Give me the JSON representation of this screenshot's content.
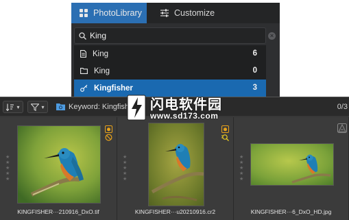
{
  "tabs": [
    {
      "label": "PhotoLibrary",
      "icon": "grid-icon",
      "active": true
    },
    {
      "label": "Customize",
      "icon": "sliders-icon",
      "active": false
    }
  ],
  "search": {
    "value": "King",
    "clear_icon": "×"
  },
  "results": [
    {
      "label": "King",
      "count": "6",
      "icon": "file-icon",
      "selected": false
    },
    {
      "label": "King",
      "count": "0",
      "icon": "folder-icon",
      "selected": false
    },
    {
      "label": "Kingfisher",
      "count": "3",
      "icon": "keyword-tag-icon",
      "selected": true
    }
  ],
  "toolbar": {
    "sort_caret": "▾",
    "filter_caret": "▾",
    "keyword_label": "Keyword: Kingfisher",
    "count_label": "0/3"
  },
  "thumbnails": [
    {
      "filename": "KINGFISHER···210916_DxO.tif",
      "badges": [
        "photo-badge-icon",
        "no-entry-badge-icon"
      ]
    },
    {
      "filename": "KINGFISHER···u20210916.cr2",
      "badges": [
        "photo-badge-icon",
        "zoom-badge-icon"
      ]
    },
    {
      "filename": "KINGFISHER···6_DxO_HD.jpg",
      "badges": [
        "exposure-warning-icon"
      ]
    }
  ],
  "watermark": {
    "title": "闪电软件园",
    "url": "www.sd173.com"
  },
  "colors": {
    "accent": "#2b6fb3",
    "selected_row": "#1a69b0",
    "badge_orange": "#e8a21a",
    "badge_yellow": "#f0d020"
  }
}
